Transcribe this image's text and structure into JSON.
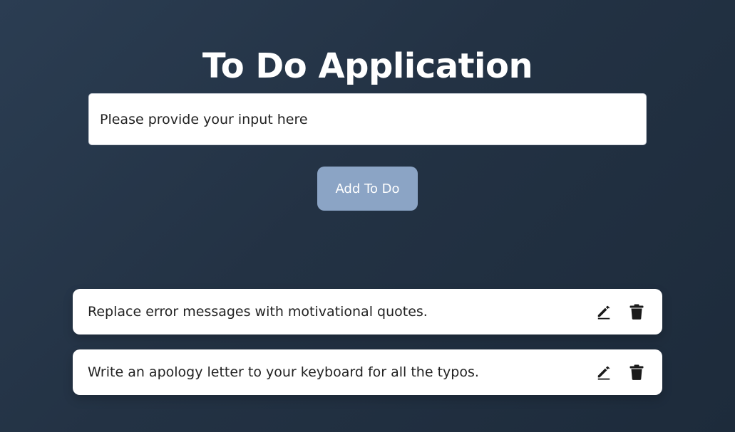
{
  "app": {
    "title": "To Do Application"
  },
  "input": {
    "placeholder": "Please provide your input here",
    "value": ""
  },
  "add_button": {
    "label": "Add To Do"
  },
  "todos": [
    {
      "text": "Replace error messages with motivational quotes.",
      "edit_icon": "pencil-icon",
      "delete_icon": "trash-icon"
    },
    {
      "text": "Write an apology letter to your keyboard for all the typos.",
      "edit_icon": "pencil-icon",
      "delete_icon": "trash-icon"
    }
  ],
  "colors": {
    "background": "#233244",
    "button": "#8ba4c5",
    "card": "#ffffff",
    "text": "#222222"
  }
}
